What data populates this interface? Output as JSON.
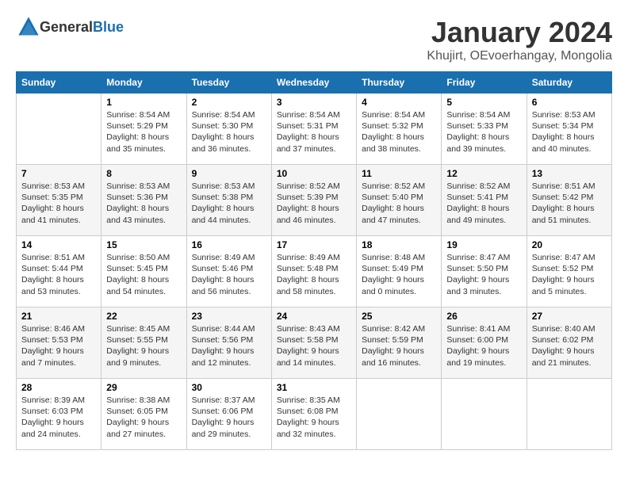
{
  "logo": {
    "text_general": "General",
    "text_blue": "Blue"
  },
  "title": {
    "month": "January 2024",
    "location": "Khujirt, OEvoerhangay, Mongolia"
  },
  "headers": [
    "Sunday",
    "Monday",
    "Tuesday",
    "Wednesday",
    "Thursday",
    "Friday",
    "Saturday"
  ],
  "weeks": [
    [
      {
        "day": "",
        "content": ""
      },
      {
        "day": "1",
        "content": "Sunrise: 8:54 AM\nSunset: 5:29 PM\nDaylight: 8 hours\nand 35 minutes."
      },
      {
        "day": "2",
        "content": "Sunrise: 8:54 AM\nSunset: 5:30 PM\nDaylight: 8 hours\nand 36 minutes."
      },
      {
        "day": "3",
        "content": "Sunrise: 8:54 AM\nSunset: 5:31 PM\nDaylight: 8 hours\nand 37 minutes."
      },
      {
        "day": "4",
        "content": "Sunrise: 8:54 AM\nSunset: 5:32 PM\nDaylight: 8 hours\nand 38 minutes."
      },
      {
        "day": "5",
        "content": "Sunrise: 8:54 AM\nSunset: 5:33 PM\nDaylight: 8 hours\nand 39 minutes."
      },
      {
        "day": "6",
        "content": "Sunrise: 8:53 AM\nSunset: 5:34 PM\nDaylight: 8 hours\nand 40 minutes."
      }
    ],
    [
      {
        "day": "7",
        "content": "Sunrise: 8:53 AM\nSunset: 5:35 PM\nDaylight: 8 hours\nand 41 minutes."
      },
      {
        "day": "8",
        "content": "Sunrise: 8:53 AM\nSunset: 5:36 PM\nDaylight: 8 hours\nand 43 minutes."
      },
      {
        "day": "9",
        "content": "Sunrise: 8:53 AM\nSunset: 5:38 PM\nDaylight: 8 hours\nand 44 minutes."
      },
      {
        "day": "10",
        "content": "Sunrise: 8:52 AM\nSunset: 5:39 PM\nDaylight: 8 hours\nand 46 minutes."
      },
      {
        "day": "11",
        "content": "Sunrise: 8:52 AM\nSunset: 5:40 PM\nDaylight: 8 hours\nand 47 minutes."
      },
      {
        "day": "12",
        "content": "Sunrise: 8:52 AM\nSunset: 5:41 PM\nDaylight: 8 hours\nand 49 minutes."
      },
      {
        "day": "13",
        "content": "Sunrise: 8:51 AM\nSunset: 5:42 PM\nDaylight: 8 hours\nand 51 minutes."
      }
    ],
    [
      {
        "day": "14",
        "content": "Sunrise: 8:51 AM\nSunset: 5:44 PM\nDaylight: 8 hours\nand 53 minutes."
      },
      {
        "day": "15",
        "content": "Sunrise: 8:50 AM\nSunset: 5:45 PM\nDaylight: 8 hours\nand 54 minutes."
      },
      {
        "day": "16",
        "content": "Sunrise: 8:49 AM\nSunset: 5:46 PM\nDaylight: 8 hours\nand 56 minutes."
      },
      {
        "day": "17",
        "content": "Sunrise: 8:49 AM\nSunset: 5:48 PM\nDaylight: 8 hours\nand 58 minutes."
      },
      {
        "day": "18",
        "content": "Sunrise: 8:48 AM\nSunset: 5:49 PM\nDaylight: 9 hours\nand 0 minutes."
      },
      {
        "day": "19",
        "content": "Sunrise: 8:47 AM\nSunset: 5:50 PM\nDaylight: 9 hours\nand 3 minutes."
      },
      {
        "day": "20",
        "content": "Sunrise: 8:47 AM\nSunset: 5:52 PM\nDaylight: 9 hours\nand 5 minutes."
      }
    ],
    [
      {
        "day": "21",
        "content": "Sunrise: 8:46 AM\nSunset: 5:53 PM\nDaylight: 9 hours\nand 7 minutes."
      },
      {
        "day": "22",
        "content": "Sunrise: 8:45 AM\nSunset: 5:55 PM\nDaylight: 9 hours\nand 9 minutes."
      },
      {
        "day": "23",
        "content": "Sunrise: 8:44 AM\nSunset: 5:56 PM\nDaylight: 9 hours\nand 12 minutes."
      },
      {
        "day": "24",
        "content": "Sunrise: 8:43 AM\nSunset: 5:58 PM\nDaylight: 9 hours\nand 14 minutes."
      },
      {
        "day": "25",
        "content": "Sunrise: 8:42 AM\nSunset: 5:59 PM\nDaylight: 9 hours\nand 16 minutes."
      },
      {
        "day": "26",
        "content": "Sunrise: 8:41 AM\nSunset: 6:00 PM\nDaylight: 9 hours\nand 19 minutes."
      },
      {
        "day": "27",
        "content": "Sunrise: 8:40 AM\nSunset: 6:02 PM\nDaylight: 9 hours\nand 21 minutes."
      }
    ],
    [
      {
        "day": "28",
        "content": "Sunrise: 8:39 AM\nSunset: 6:03 PM\nDaylight: 9 hours\nand 24 minutes."
      },
      {
        "day": "29",
        "content": "Sunrise: 8:38 AM\nSunset: 6:05 PM\nDaylight: 9 hours\nand 27 minutes."
      },
      {
        "day": "30",
        "content": "Sunrise: 8:37 AM\nSunset: 6:06 PM\nDaylight: 9 hours\nand 29 minutes."
      },
      {
        "day": "31",
        "content": "Sunrise: 8:35 AM\nSunset: 6:08 PM\nDaylight: 9 hours\nand 32 minutes."
      },
      {
        "day": "",
        "content": ""
      },
      {
        "day": "",
        "content": ""
      },
      {
        "day": "",
        "content": ""
      }
    ]
  ]
}
